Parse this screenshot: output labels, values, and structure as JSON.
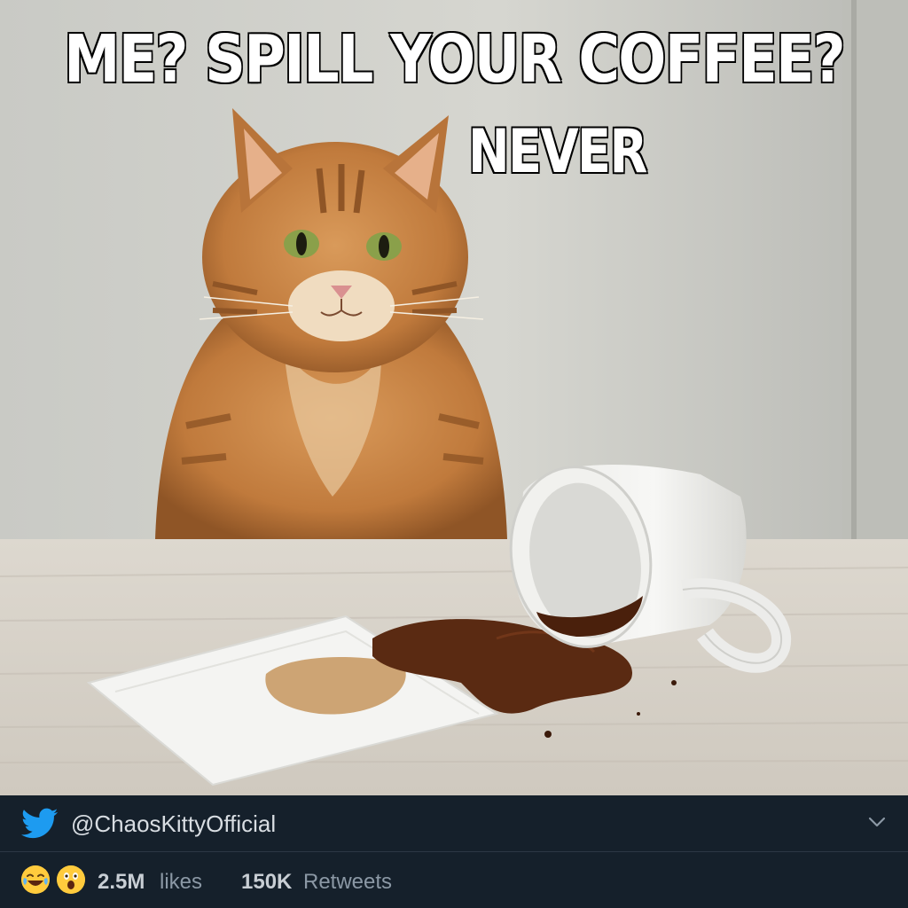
{
  "meme": {
    "top_text": "ME? SPILL YOUR COFFEE?",
    "bottom_text": "NEVER"
  },
  "tweet": {
    "handle": "@ChaosKittyOfficial",
    "icons": [
      "twitter-bird-icon",
      "chevron-down-icon",
      "laughing-emoji-icon",
      "astonished-emoji-icon"
    ],
    "brand_color": "#1d9bf0",
    "background_color": "#15202b",
    "likes_count": "2.5M",
    "likes_label": "likes",
    "retweets_count": "150K",
    "retweets_label": "Retweets"
  }
}
